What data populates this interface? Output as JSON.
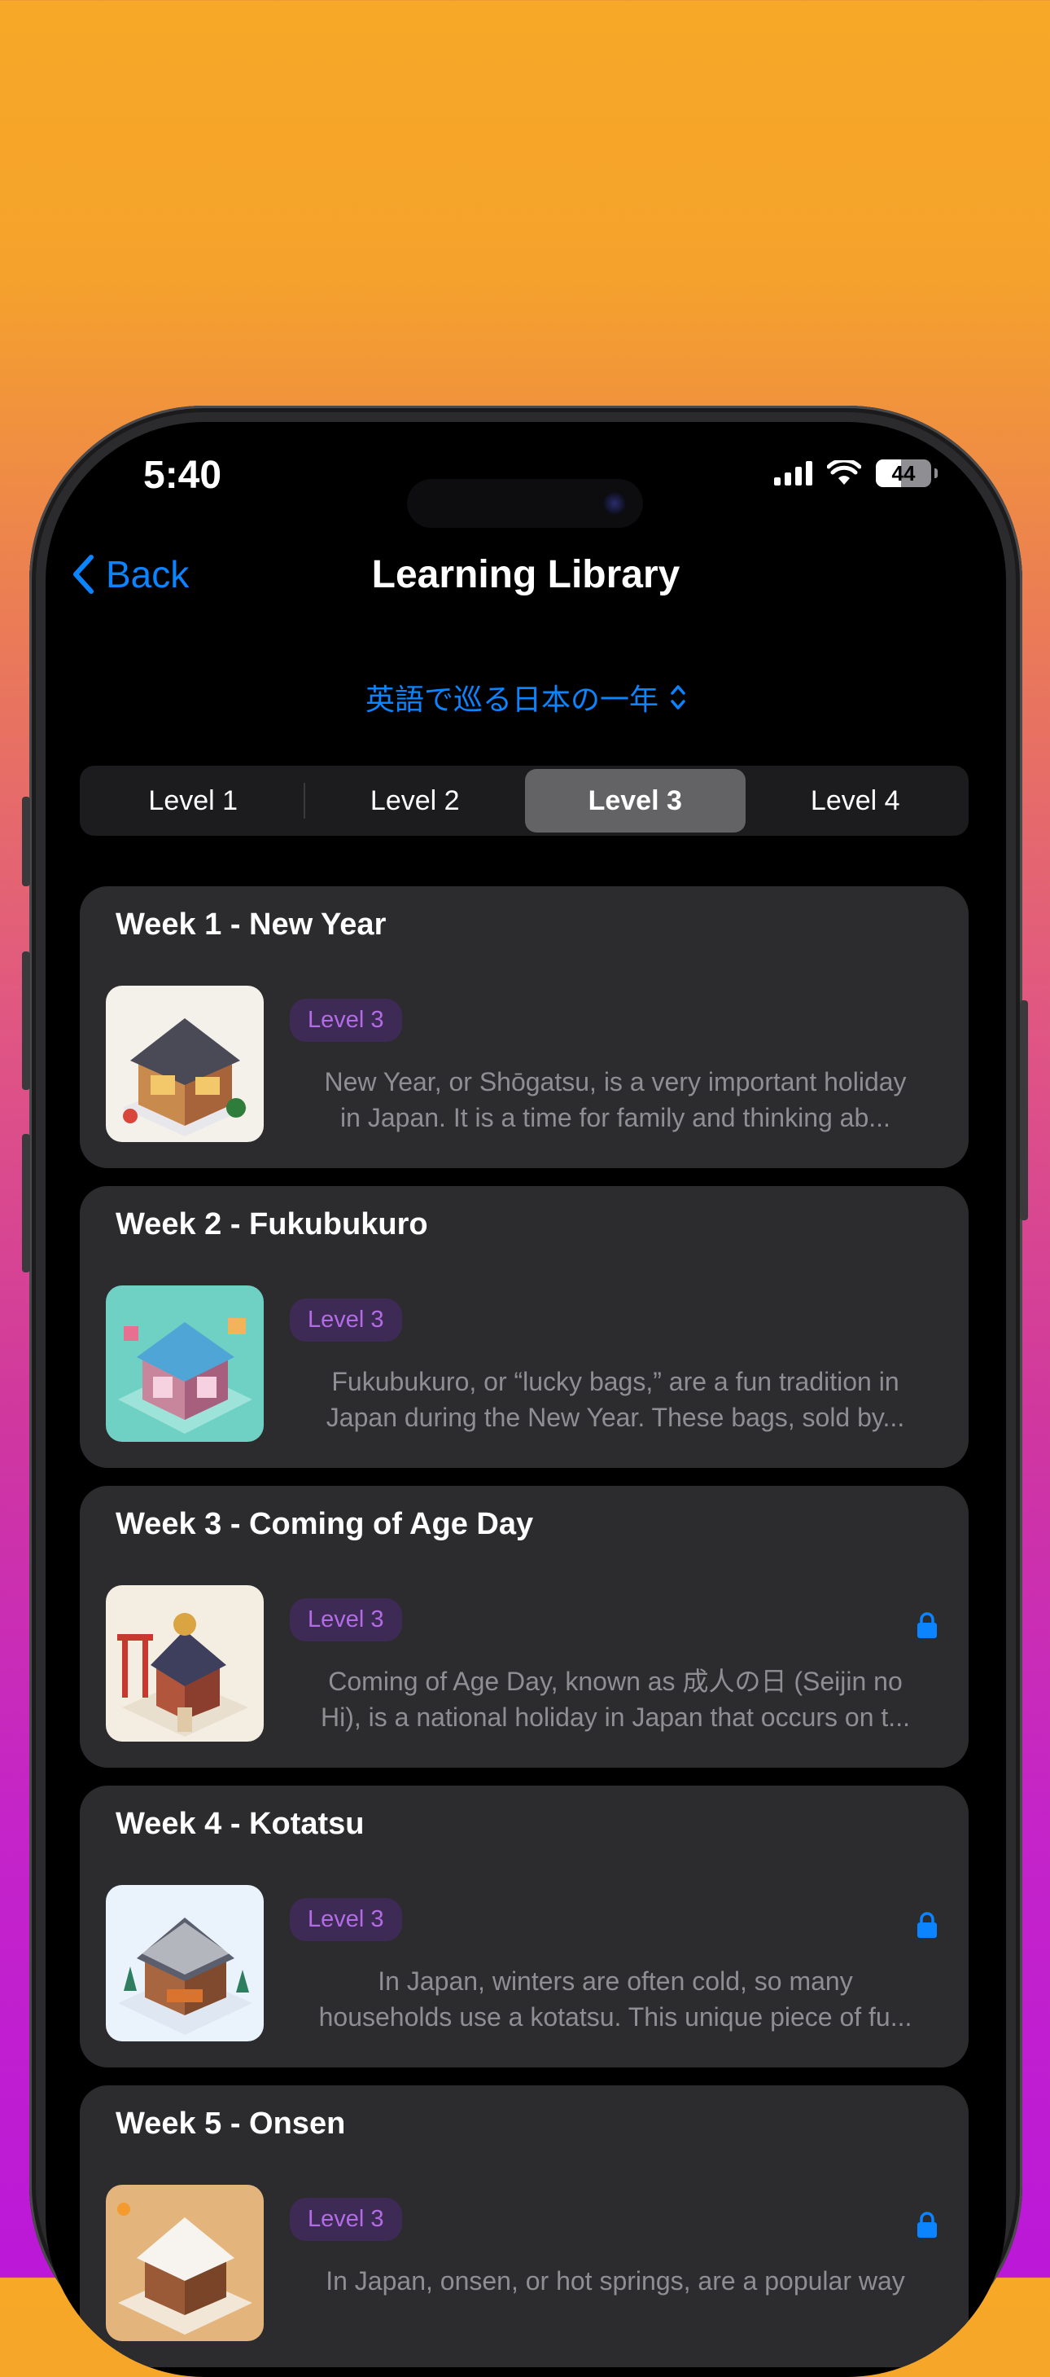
{
  "status_bar": {
    "time": "5:40",
    "battery": "44"
  },
  "nav": {
    "back_label": "Back",
    "title": "Learning Library"
  },
  "picker": {
    "label": "英語で巡る日本の一年"
  },
  "levels": [
    "Level 1",
    "Level 2",
    "Level 3",
    "Level 4"
  ],
  "selected_level": "Level 3",
  "colors": {
    "accent": "#0a84ff",
    "badge_text": "#b36be6",
    "card_bg": "#2c2c2e"
  },
  "weeks": [
    {
      "title": "Week 1 - New Year",
      "badge": "Level 3",
      "locked": false,
      "icon": "new-year-house-thumbnail",
      "desc_line1": "New Year, or Shōgatsu, is a very important holiday",
      "desc_line2": "in Japan. It is a time for family and thinking ab..."
    },
    {
      "title": "Week 2 - Fukubukuro",
      "badge": "Level 3",
      "locked": false,
      "icon": "fukubukuro-shop-thumbnail",
      "desc_line1": "Fukubukuro, or “lucky bags,” are a fun tradition in",
      "desc_line2": "Japan during the New Year. These bags, sold by..."
    },
    {
      "title": "Week 3 - Coming of Age Day",
      "badge": "Level 3",
      "locked": true,
      "icon": "shrine-thumbnail",
      "desc_line1": "Coming of Age Day, known as 成人の日 (Seijin no",
      "desc_line2": "Hi), is a national holiday in Japan that occurs on t..."
    },
    {
      "title": "Week 4 - Kotatsu",
      "badge": "Level 3",
      "locked": true,
      "icon": "kotatsu-house-thumbnail",
      "desc_line1": "In Japan, winters are often cold, so many",
      "desc_line2": "households use a kotatsu. This unique piece of fu..."
    },
    {
      "title": "Week 5 - Onsen",
      "badge": "Level 3",
      "locked": true,
      "icon": "onsen-thumbnail",
      "desc_line1": "In Japan, onsen, or hot springs, are a popular way",
      "desc_line2": ""
    }
  ]
}
